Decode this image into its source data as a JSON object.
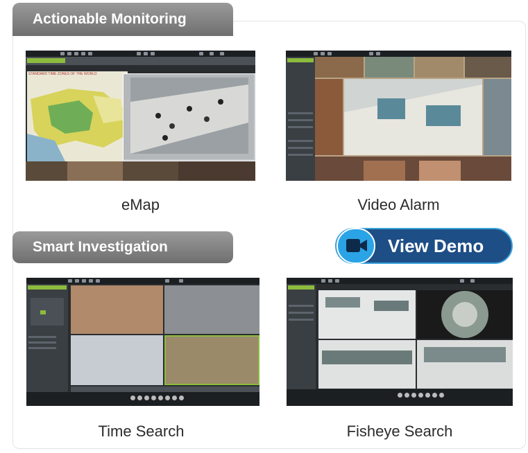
{
  "sections": {
    "monitoring_title": "Actionable Monitoring",
    "investigation_title": "Smart Investigation"
  },
  "cards": {
    "emap": "eMap",
    "video_alarm": "Video Alarm",
    "time_search": "Time Search",
    "fisheye_search": "Fisheye Search"
  },
  "demo_button": {
    "label": "View Demo",
    "icon": "video-camera-icon",
    "color": "#1e4e86",
    "accent": "#2aa4e6"
  },
  "map_caption": "STANDARD TIME ZONES OF THE WORLD"
}
